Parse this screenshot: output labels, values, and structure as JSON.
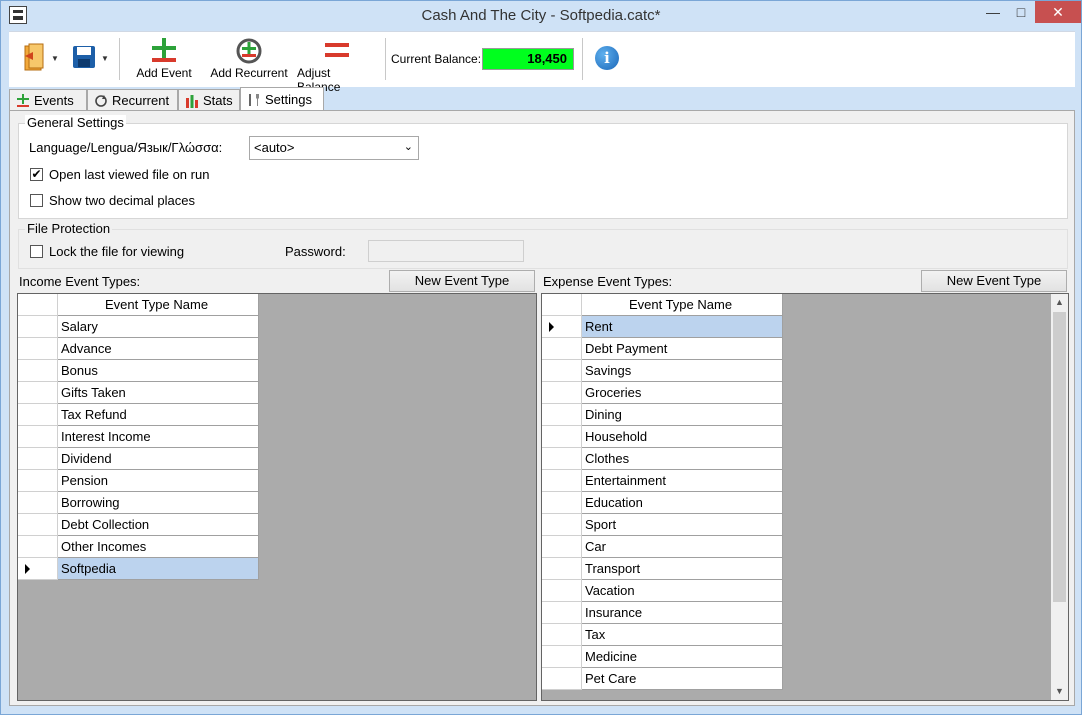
{
  "window": {
    "title": "Cash And The City - Softpedia.catc*",
    "minimize": "—",
    "maximize": "□",
    "close": "✕"
  },
  "toolbar": {
    "add_event": "Add Event",
    "add_recurrent": "Add Recurrent",
    "adjust_balance": "Adjust Balance",
    "balance_label": "Current Balance:",
    "balance_value": "18,450",
    "info": "i",
    "dropdown_arrow": "▼"
  },
  "tabs": [
    {
      "label": "Events",
      "icon": "plus-minus-icon"
    },
    {
      "label": "Recurrent",
      "icon": "refresh-icon"
    },
    {
      "label": "Stats",
      "icon": "bar-chart-icon"
    },
    {
      "label": "Settings",
      "icon": "tools-icon"
    }
  ],
  "general": {
    "title": "General Settings",
    "language_label": "Language/Lengua/Язык/Γλώσσα:",
    "language_value": "<auto>",
    "open_last": "Open last viewed file on run",
    "open_last_checked": true,
    "two_decimals": "Show two decimal places",
    "two_decimals_checked": false
  },
  "protection": {
    "title": "File Protection",
    "lock_label": "Lock the file for viewing",
    "lock_checked": false,
    "password_label": "Password:"
  },
  "income": {
    "title": "Income Event Types:",
    "new_button": "New Event Type",
    "column": "Event Type Name",
    "rows": [
      "Salary",
      "Advance",
      "Bonus",
      "Gifts Taken",
      "Tax Refund",
      "Interest Income",
      "Dividend",
      "Pension",
      "Borrowing",
      "Debt Collection",
      "Other Incomes",
      "Softpedia"
    ],
    "selected": "Softpedia"
  },
  "expense": {
    "title": "Expense Event Types:",
    "new_button": "New Event Type",
    "column": "Event Type Name",
    "rows": [
      "Rent",
      "Debt Payment",
      "Savings",
      "Groceries",
      "Dining",
      "Household",
      "Clothes",
      "Entertainment",
      "Education",
      "Sport",
      "Car",
      "Transport",
      "Vacation",
      "Insurance",
      "Tax",
      "Medicine",
      "Pet Care"
    ],
    "selected": "Rent"
  }
}
